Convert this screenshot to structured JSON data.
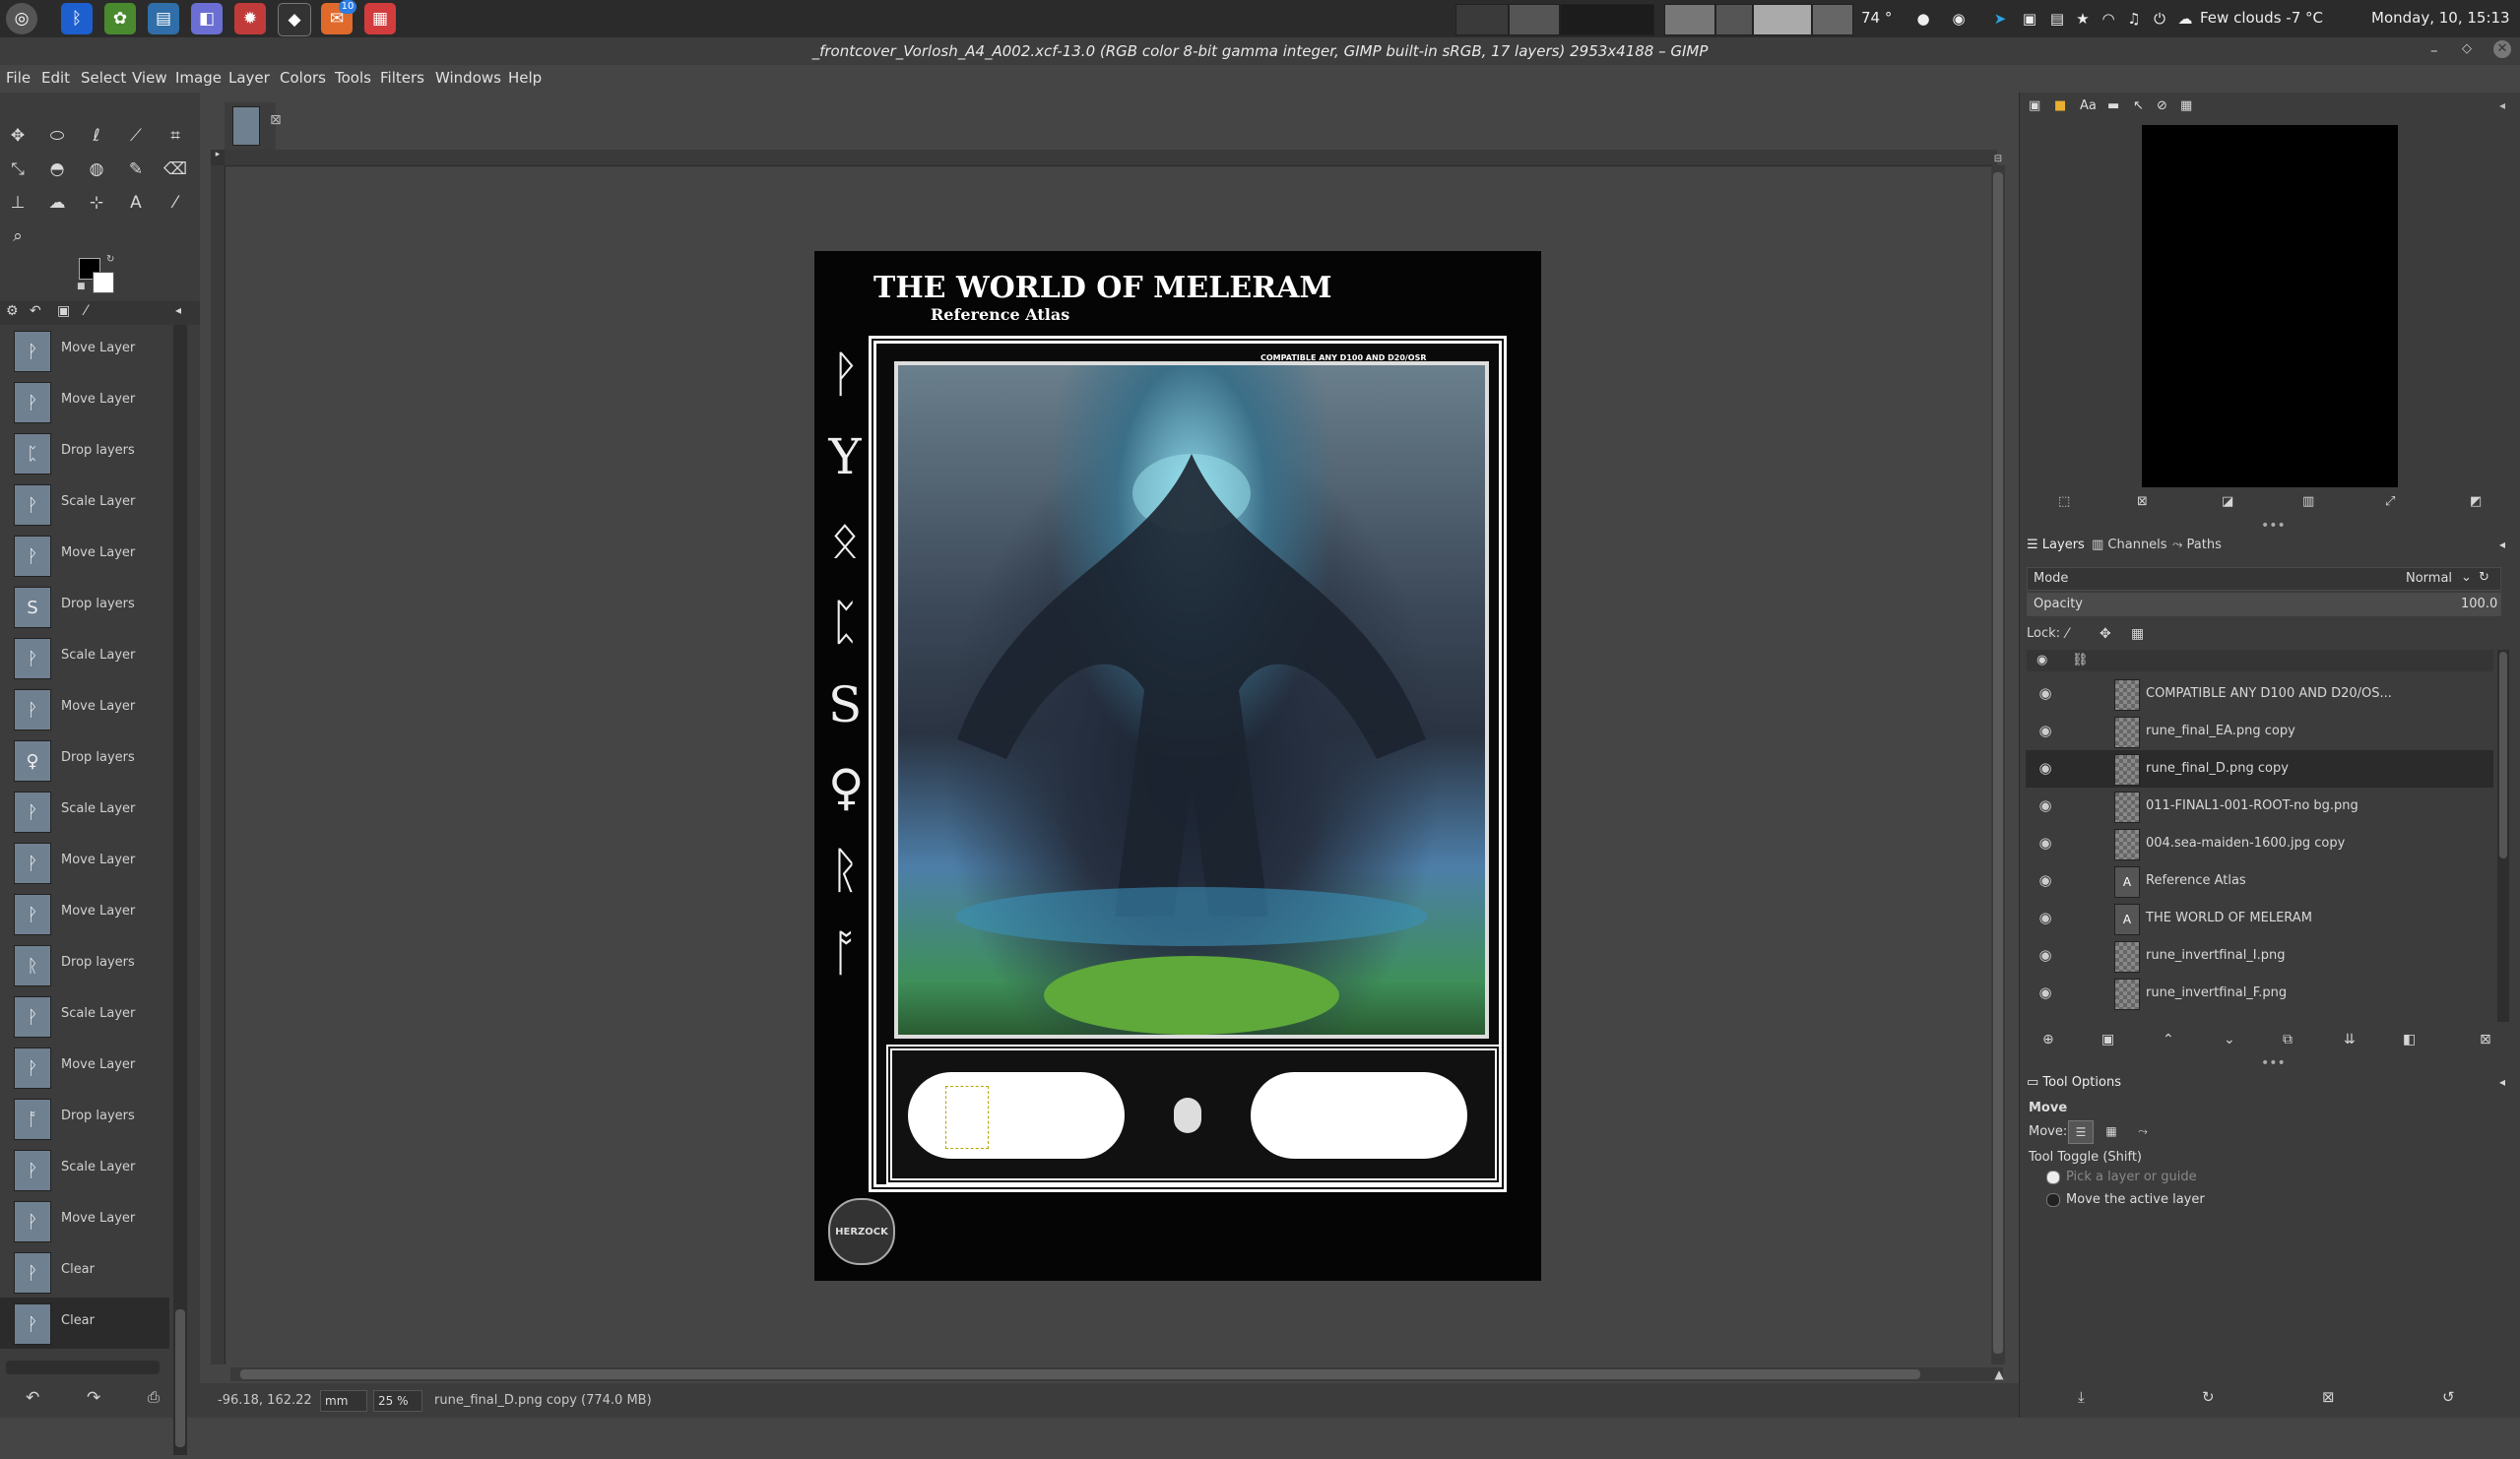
{
  "system_bar": {
    "temperature": "74 °",
    "weather": "Few clouds -7 °C",
    "datetime": "Monday, 10, 15:13",
    "badge_count": "10"
  },
  "window": {
    "title": "_frontcover_Vorlosh_A4_A002.xcf-13.0 (RGB color 8-bit gamma integer, GIMP built-in sRGB, 17 layers) 2953x4188 – GIMP"
  },
  "menu": [
    "File",
    "Edit",
    "Select",
    "View",
    "Image",
    "Layer",
    "Colors",
    "Tools",
    "Filters",
    "Windows",
    "Help"
  ],
  "history": [
    {
      "label": "Move Layer",
      "glyph": "ᚹ"
    },
    {
      "label": "Move Layer",
      "glyph": "ᚹ"
    },
    {
      "label": "Drop layers",
      "glyph": "ᛈ"
    },
    {
      "label": "Scale Layer",
      "glyph": "ᚹ"
    },
    {
      "label": "Move Layer",
      "glyph": "ᚹ"
    },
    {
      "label": "Drop layers",
      "glyph": "S"
    },
    {
      "label": "Scale Layer",
      "glyph": "ᚹ"
    },
    {
      "label": "Move Layer",
      "glyph": "ᚹ"
    },
    {
      "label": "Drop layers",
      "glyph": "♀"
    },
    {
      "label": "Scale Layer",
      "glyph": "ᚹ"
    },
    {
      "label": "Move Layer",
      "glyph": "ᚹ"
    },
    {
      "label": "Move Layer",
      "glyph": "ᚹ"
    },
    {
      "label": "Drop layers",
      "glyph": "ᚱ"
    },
    {
      "label": "Scale Layer",
      "glyph": "ᚹ"
    },
    {
      "label": "Move Layer",
      "glyph": "ᚹ"
    },
    {
      "label": "Drop layers",
      "glyph": "ᚩ"
    },
    {
      "label": "Scale Layer",
      "glyph": "ᚹ"
    },
    {
      "label": "Move Layer",
      "glyph": "ᚹ"
    },
    {
      "label": "Clear",
      "glyph": "ᚹ"
    },
    {
      "label": "Clear",
      "glyph": "ᚹ"
    }
  ],
  "canvas": {
    "doc_title": "THE WORLD OF MELERAM",
    "doc_subtitle": "Reference Atlas",
    "compat_text": "COMPATIBLE ANY D100 AND D20/OSR",
    "logo_text": "HERZOCK",
    "runes": [
      "ᚹ",
      "Y",
      "ᛟ",
      "ᛈ",
      "S",
      "♀",
      "ᚱ",
      "ᚩ"
    ]
  },
  "status": {
    "coords": "-96.18, 162.22",
    "unit": "mm",
    "zoom": "25 %",
    "info": "rune_final_D.png copy (774.0 MB)"
  },
  "layers_panel": {
    "tabs": [
      "Layers",
      "Channels",
      "Paths"
    ],
    "mode_label": "Mode",
    "mode_value": "Normal",
    "opacity_label": "Opacity",
    "opacity_value": "100.0",
    "lock_label": "Lock:",
    "layers": [
      {
        "name": "COMPATIBLE ANY D100 AND D20/OS...",
        "selected": false,
        "text": false
      },
      {
        "name": "rune_final_EA.png copy",
        "selected": false,
        "text": false
      },
      {
        "name": "rune_final_D.png copy",
        "selected": true,
        "text": false
      },
      {
        "name": "011-FINAL1-001-ROOT-no bg.png",
        "selected": false,
        "text": false
      },
      {
        "name": "004.sea-maiden-1600.jpg copy",
        "selected": false,
        "text": false
      },
      {
        "name": "Reference Atlas",
        "selected": false,
        "text": true
      },
      {
        "name": "THE WORLD OF MELERAM",
        "selected": false,
        "text": true
      },
      {
        "name": "rune_invertfinal_I.png",
        "selected": false,
        "text": false
      },
      {
        "name": "rune_invertfinal_F.png",
        "selected": false,
        "text": false
      }
    ]
  },
  "tool_options": {
    "tab": "Tool Options",
    "tool_name": "Move",
    "move_label": "Move:",
    "toggle_label": "Tool Toggle  (Shift)",
    "option1": "Pick a layer or guide",
    "option2": "Move the active layer"
  }
}
